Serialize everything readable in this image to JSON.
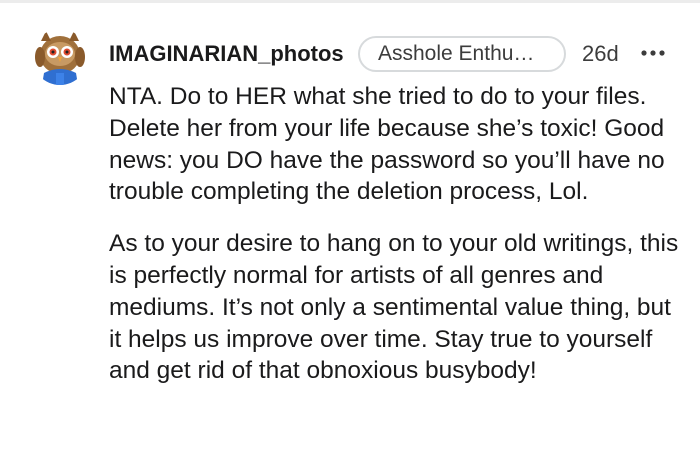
{
  "comment": {
    "username": "IMAGINARIAN_photos",
    "flair": "Asshole Enthu…",
    "age": "26d",
    "paragraphs": [
      "NTA. Do to HER what she tried to do to your files. Delete her from your life because she’s toxic! Good news: you DO have the password so you’ll have no trouble completing the deletion process, Lol.",
      "As to your desire to hang on to your old writings, this is perfectly normal for artists of all genres and mediums. It’s not only a sentimental value thing, but it helps us improve over time. Stay true to yourself and get rid of that obnoxious busybody!"
    ],
    "icons": {
      "avatar": "owl-avatar-icon",
      "more": "more-options-icon"
    },
    "colors": {
      "text": "#1a1a1b",
      "muted": "#3c3c3c",
      "flair_border": "#d7dadc",
      "divider": "#ececec"
    }
  }
}
